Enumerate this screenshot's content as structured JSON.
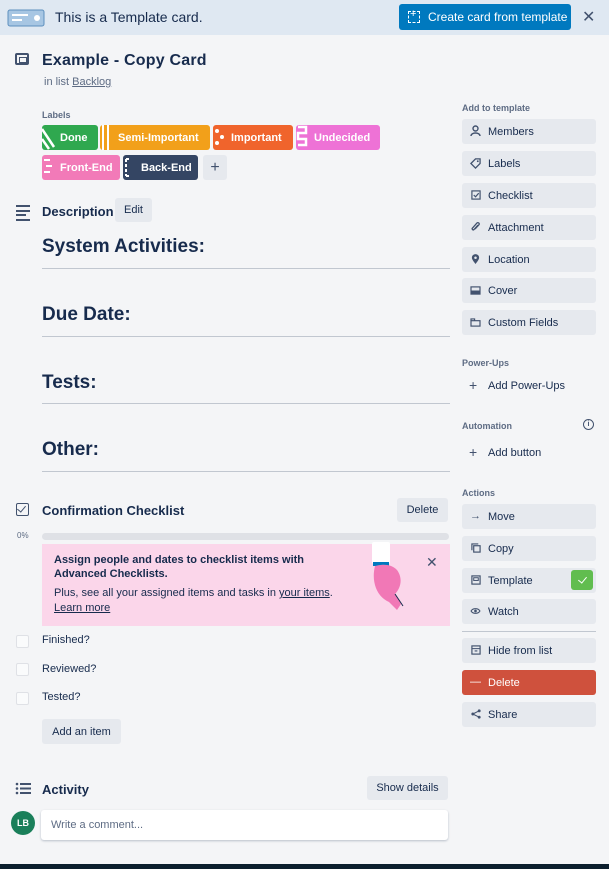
{
  "banner": {
    "text": "This is a Template card.",
    "create_label": "Create card from template",
    "close": "✕"
  },
  "card": {
    "title": "Example - Copy Card",
    "in_list_prefix": "in list",
    "list_name": "Backlog"
  },
  "labels": {
    "title": "Labels",
    "items": [
      {
        "text": "Done",
        "color": "#2fa84f"
      },
      {
        "text": "Semi-Important",
        "color": "#f2a01a"
      },
      {
        "text": "Important",
        "color": "#f0642c"
      },
      {
        "text": "Undecided",
        "color": "#ee72d6"
      },
      {
        "text": "Front-End",
        "color": "#f27ab8"
      },
      {
        "text": "Back-End",
        "color": "#344563"
      }
    ],
    "add": "+"
  },
  "description": {
    "title": "Description",
    "edit_label": "Edit",
    "sections": [
      "System Activities:",
      "Due Date:",
      "Tests:",
      "Other:"
    ]
  },
  "checklist": {
    "title": "Confirmation Checklist",
    "delete_label": "Delete",
    "progress": "0%",
    "progress_value": 0,
    "promo": {
      "title": "Assign people and dates to checklist items with Advanced Checklists.",
      "text_prefix": "Plus, see all your assigned items and tasks in",
      "link1": "your items",
      "text_suffix": ".",
      "link2": "Learn more",
      "close": "✕"
    },
    "items": [
      "Finished?",
      "Reviewed?",
      "Tested?"
    ],
    "add_item_label": "Add an item"
  },
  "activity": {
    "title": "Activity",
    "show_details_label": "Show details",
    "avatar_initials": "LB",
    "comment_placeholder": "Write a comment..."
  },
  "sidebar": {
    "add_to_template_heading": "Add to template",
    "add_to_template": [
      {
        "label": "Members",
        "icon": "person-icon"
      },
      {
        "label": "Labels",
        "icon": "tag-icon"
      },
      {
        "label": "Checklist",
        "icon": "checkbox-icon"
      },
      {
        "label": "Attachment",
        "icon": "paperclip-icon"
      },
      {
        "label": "Location",
        "icon": "pin-icon"
      },
      {
        "label": "Cover",
        "icon": "cover-icon"
      },
      {
        "label": "Custom Fields",
        "icon": "fields-icon"
      }
    ],
    "powerups_heading": "Power-Ups",
    "add_powerups_label": "Add Power-Ups",
    "automation_heading": "Automation",
    "add_button_label": "Add button",
    "actions_heading": "Actions",
    "actions": [
      {
        "label": "Move",
        "icon": "arrow-right-icon"
      },
      {
        "label": "Copy",
        "icon": "copy-icon"
      },
      {
        "label": "Template",
        "icon": "template-icon"
      },
      {
        "label": "Watch",
        "icon": "eye-icon"
      },
      {
        "label": "Hide from list",
        "icon": "archive-icon"
      },
      {
        "label": "Delete",
        "icon": "minus-icon"
      },
      {
        "label": "Share",
        "icon": "share-icon"
      }
    ]
  },
  "colors": {
    "primary": "#0079bf",
    "delete": "#cf513d",
    "success": "#61bd4f",
    "promo_bg": "#fbd6ea"
  }
}
